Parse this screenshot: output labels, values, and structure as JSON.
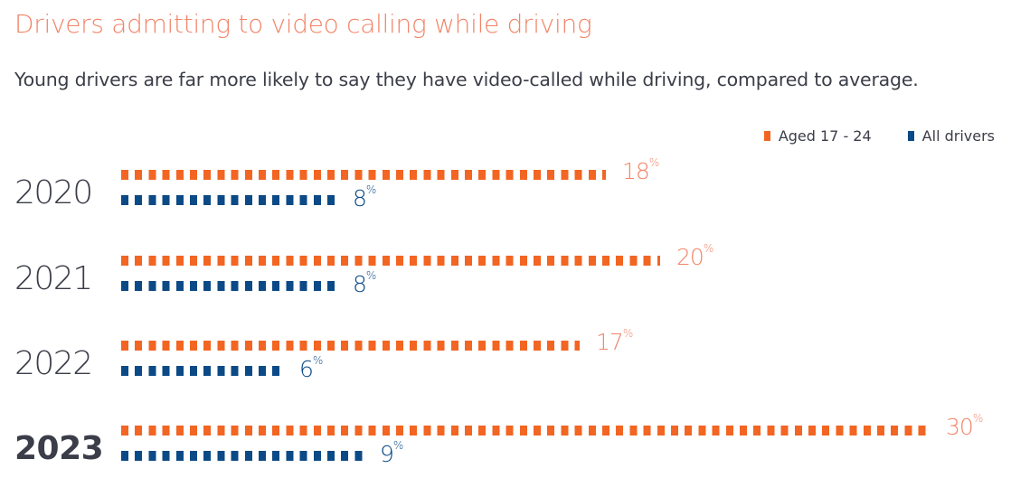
{
  "title": "Drivers admitting to video calling while driving",
  "subtitle": "Young drivers are far more likely to say they have video-called while driving, compared to average.",
  "colors": {
    "young": "#f26522",
    "all": "#0b4a86",
    "title": "#f28468",
    "text": "#3b3d48"
  },
  "legend": [
    {
      "label": "Aged 17 - 24",
      "color": "#f26522"
    },
    {
      "label": "All drivers",
      "color": "#0b4a86"
    }
  ],
  "chart_data": {
    "type": "bar",
    "orientation": "horizontal",
    "title": "Drivers admitting to video calling while driving",
    "subtitle": "Young drivers are far more likely to say they have video-called while driving, compared to average.",
    "categories": [
      "2020",
      "2021",
      "2022",
      "2023"
    ],
    "highlighted_category": "2023",
    "unit": "%",
    "series": [
      {
        "name": "Aged 17 - 24",
        "color": "#f26522",
        "values": [
          18,
          20,
          17,
          30
        ]
      },
      {
        "name": "All drivers",
        "color": "#0b4a86",
        "values": [
          8,
          8,
          6,
          9
        ]
      }
    ],
    "xlim": [
      0,
      30
    ],
    "grid": false,
    "legend_position": "top-right",
    "style": "dotted bars (square markers)"
  }
}
